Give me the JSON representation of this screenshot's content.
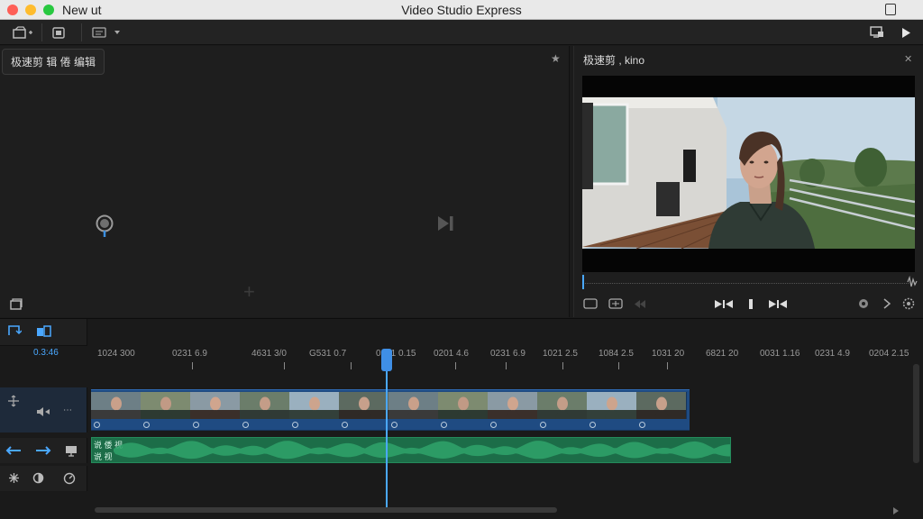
{
  "window": {
    "left_text": "New ut",
    "title": "Video Studio Express"
  },
  "browser_panel": {
    "chip_label": "极速剪 辑 倦 编辑"
  },
  "viewer": {
    "title": "极速剪 , kino"
  },
  "timeline": {
    "timecode": "0.3:46",
    "ruler_labels": [
      "1024 300",
      "0231 6.9",
      "4631 3/0",
      "G531 0.7",
      "0131 0.15",
      "0201 4.6",
      "0231 6.9",
      "1021 2.5",
      "1084 2.5",
      "1031 20",
      "6821 20",
      "0031 1.16",
      "0231 4.9",
      "0204 2.15"
    ],
    "audio_track_label_top": "说 倭 视",
    "audio_track_label_bottom": "说 视"
  },
  "colors": {
    "accent": "#4aa8ff",
    "video_clip": "#1f4b82",
    "audio_clip": "#1c6d48"
  }
}
